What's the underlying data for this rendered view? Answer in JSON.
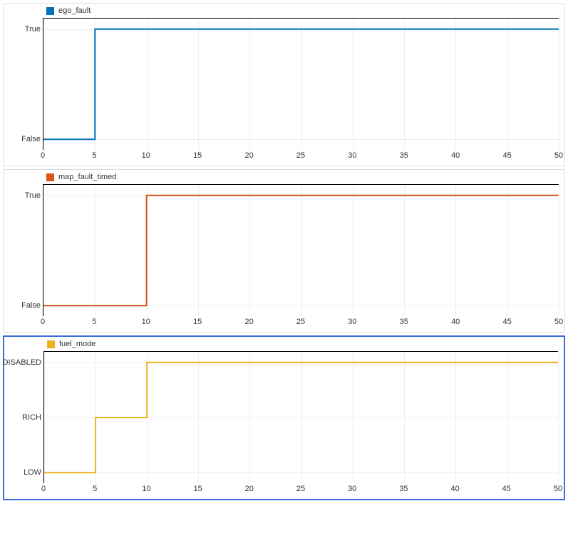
{
  "x_ticks": [
    0,
    5,
    10,
    15,
    20,
    25,
    30,
    35,
    40,
    45,
    50
  ],
  "x_range": [
    0,
    50
  ],
  "panels": [
    {
      "id": "ego_fault",
      "legend": "ego_fault",
      "color": "#0072bd",
      "selected": false,
      "y_ticks": [
        "False",
        "True"
      ],
      "data_map": {
        "False": 0,
        "True": 1
      },
      "steps": [
        [
          0,
          "False"
        ],
        [
          5,
          "True"
        ],
        [
          50,
          "True"
        ]
      ]
    },
    {
      "id": "map_fault_timed",
      "legend": "map_fault_timed",
      "color": "#d95319",
      "selected": false,
      "y_ticks": [
        "False",
        "True"
      ],
      "data_map": {
        "False": 0,
        "True": 1
      },
      "steps": [
        [
          0,
          "False"
        ],
        [
          10,
          "True"
        ],
        [
          50,
          "True"
        ]
      ]
    },
    {
      "id": "fuel_mode",
      "legend": "fuel_mode",
      "color": "#edb120",
      "selected": true,
      "y_ticks": [
        "LOW",
        "RICH",
        "DISABLED"
      ],
      "data_map": {
        "LOW": 0,
        "RICH": 1,
        "DISABLED": 2
      },
      "steps": [
        [
          0,
          "LOW"
        ],
        [
          5,
          "RICH"
        ],
        [
          10,
          "DISABLED"
        ],
        [
          50,
          "DISABLED"
        ]
      ]
    }
  ],
  "chart_data": [
    {
      "type": "line",
      "title": "ego_fault",
      "xlabel": "",
      "ylabel": "",
      "xlim": [
        0,
        50
      ],
      "y_categories": [
        "False",
        "True"
      ],
      "series": [
        {
          "name": "ego_fault",
          "color": "#0072bd",
          "x": [
            0,
            5,
            5,
            50
          ],
          "y": [
            "False",
            "False",
            "True",
            "True"
          ]
        }
      ]
    },
    {
      "type": "line",
      "title": "map_fault_timed",
      "xlabel": "",
      "ylabel": "",
      "xlim": [
        0,
        50
      ],
      "y_categories": [
        "False",
        "True"
      ],
      "series": [
        {
          "name": "map_fault_timed",
          "color": "#d95319",
          "x": [
            0,
            10,
            10,
            50
          ],
          "y": [
            "False",
            "False",
            "True",
            "True"
          ]
        }
      ]
    },
    {
      "type": "line",
      "title": "fuel_mode",
      "xlabel": "",
      "ylabel": "",
      "xlim": [
        0,
        50
      ],
      "y_categories": [
        "LOW",
        "RICH",
        "DISABLED"
      ],
      "series": [
        {
          "name": "fuel_mode",
          "color": "#edb120",
          "x": [
            0,
            5,
            5,
            10,
            10,
            50
          ],
          "y": [
            "LOW",
            "LOW",
            "RICH",
            "RICH",
            "DISABLED",
            "DISABLED"
          ]
        }
      ]
    }
  ]
}
